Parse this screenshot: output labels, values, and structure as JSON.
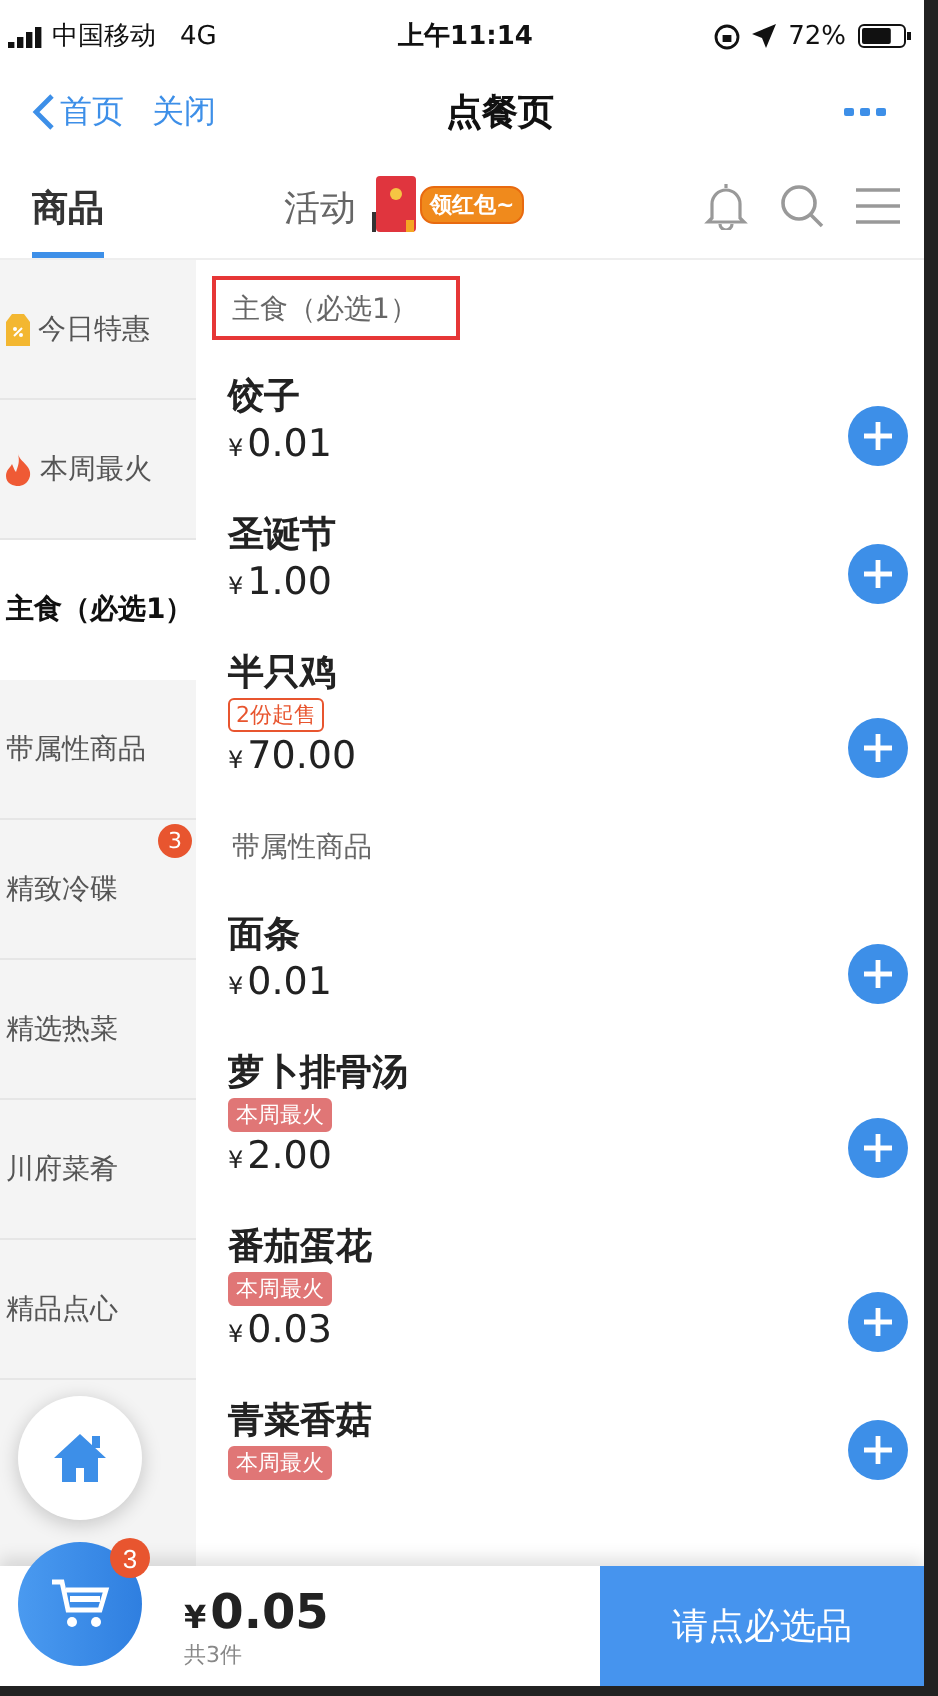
{
  "status_bar": {
    "carrier": "中国移动",
    "network": "4G",
    "time": "上午11:14",
    "battery": "72%"
  },
  "nav": {
    "back": "首页",
    "close": "关闭",
    "title": "点餐页"
  },
  "tabs": [
    {
      "label": "商品",
      "selected": true
    },
    {
      "label": "活动",
      "selected": false
    }
  ],
  "promo": {
    "label": "领红包~"
  },
  "sidebar": {
    "items": [
      {
        "label": "今日特惠",
        "kind": "deal",
        "selected": false
      },
      {
        "label": "本周最火",
        "kind": "hot",
        "selected": false
      },
      {
        "label": "主食（必选1）",
        "kind": "plain",
        "selected": true
      },
      {
        "label": "带属性商品",
        "kind": "plain",
        "selected": false
      },
      {
        "label": "精致冷碟",
        "kind": "plain",
        "badge": "3",
        "selected": false
      },
      {
        "label": "精选热菜",
        "kind": "plain",
        "selected": false
      },
      {
        "label": "川府菜肴",
        "kind": "plain",
        "selected": false
      },
      {
        "label": "精品点心",
        "kind": "plain",
        "selected": false
      }
    ]
  },
  "sections": [
    {
      "title": "主食（必选1）",
      "highlighted": true,
      "items": [
        {
          "name": "饺子",
          "currency": "¥",
          "price": "0.01"
        },
        {
          "name": "圣诞节",
          "currency": "¥",
          "price": "1.00"
        },
        {
          "name": "半只鸡",
          "tag": {
            "text": "2份起售",
            "kind": "outline"
          },
          "currency": "¥",
          "price": "70.00"
        }
      ]
    },
    {
      "title": "带属性商品",
      "highlighted": false,
      "items": [
        {
          "name": "面条",
          "currency": "¥",
          "price": "0.01"
        },
        {
          "name": "萝卜排骨汤",
          "tag": {
            "text": "本周最火",
            "kind": "filled"
          },
          "currency": "¥",
          "price": "2.00"
        },
        {
          "name": "番茄蛋花",
          "tag": {
            "text": "本周最火",
            "kind": "filled"
          },
          "currency": "¥",
          "price": "0.03"
        },
        {
          "name": "青菜香菇",
          "tag": {
            "text": "本周最火",
            "kind": "filled"
          }
        }
      ]
    }
  ],
  "cart": {
    "count": "3",
    "currency": "¥",
    "total": "0.05",
    "note": "共3件",
    "checkout": "请点必选品"
  }
}
